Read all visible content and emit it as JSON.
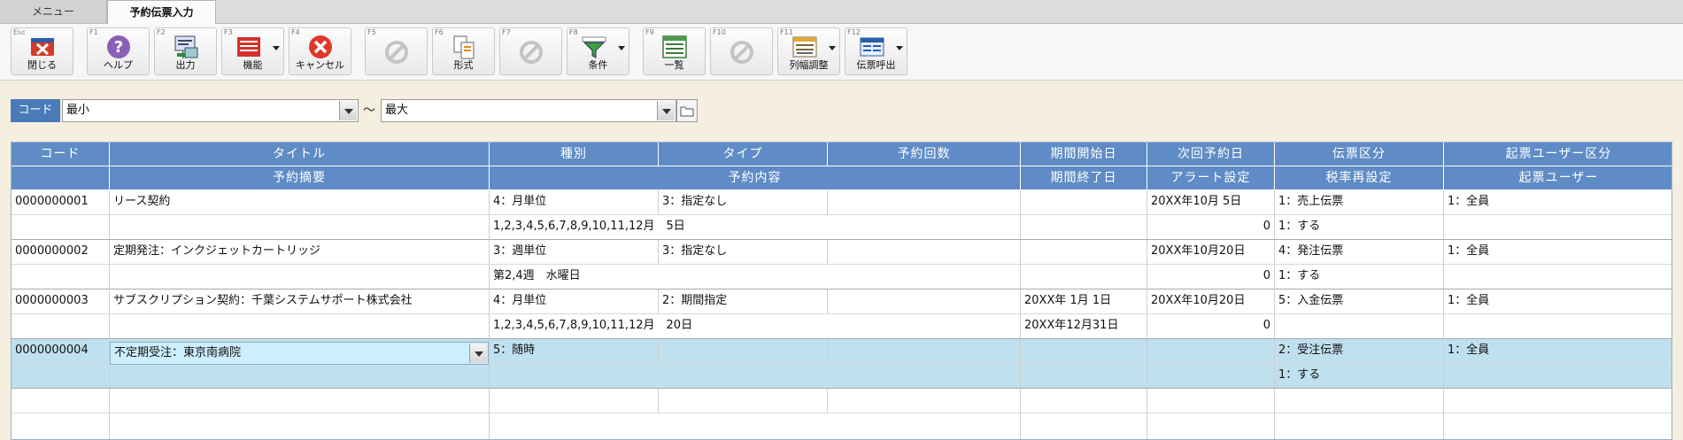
{
  "tabs": {
    "menu": "メニュー",
    "active": "予約伝票入力"
  },
  "toolbar": [
    {
      "key": "Esc",
      "label": "閉じる",
      "icon": "close-window-icon",
      "enabled": true
    },
    {
      "key": "F1",
      "label": "ヘルプ",
      "icon": "help-icon",
      "enabled": true
    },
    {
      "key": "F2",
      "label": "出力",
      "icon": "output-icon",
      "enabled": true
    },
    {
      "key": "F3",
      "label": "機能",
      "icon": "function-icon",
      "enabled": true,
      "dropdown": true
    },
    {
      "key": "F4",
      "label": "キャンセル",
      "icon": "cancel-icon",
      "enabled": true
    },
    {
      "key": "F5",
      "label": "",
      "icon": "disabled-icon",
      "enabled": false
    },
    {
      "key": "F6",
      "label": "形式",
      "icon": "format-icon",
      "enabled": true
    },
    {
      "key": "F7",
      "label": "",
      "icon": "disabled-icon",
      "enabled": false
    },
    {
      "key": "F8",
      "label": "条件",
      "icon": "filter-icon",
      "enabled": true,
      "dropdown": true
    },
    {
      "key": "F9",
      "label": "一覧",
      "icon": "list-icon",
      "enabled": true
    },
    {
      "key": "F10",
      "label": "",
      "icon": "disabled-icon",
      "enabled": false
    },
    {
      "key": "F11",
      "label": "列幅調整",
      "icon": "column-width-icon",
      "enabled": true,
      "dropdown": true
    },
    {
      "key": "F12",
      "label": "伝票呼出",
      "icon": "slip-call-icon",
      "enabled": true,
      "dropdown": true
    }
  ],
  "filter": {
    "label": "コード",
    "from": "最小",
    "tilde": "〜",
    "to": "最大"
  },
  "grid": {
    "header_row1": [
      "コード",
      "タイトル",
      "種別",
      "タイプ",
      "予約回数",
      "期間開始日",
      "次回予約日",
      "伝票区分",
      "起票ユーザー区分"
    ],
    "header_row2": [
      "予約摘要",
      "予約内容",
      "期間終了日",
      "アラート設定",
      "税率再設定",
      "起票ユーザー"
    ],
    "records": [
      {
        "code": "0000000001",
        "title": "リース契約",
        "kind": "4：月単位",
        "type": "3：指定なし",
        "count": "",
        "start": "",
        "next": "20XX年10月 5日",
        "slip": " 1：売上伝票",
        "user_kind": "1：全員",
        "memo": "",
        "content": "1,2,3,4,5,6,7,8,9,10,11,12月　5日",
        "end": "",
        "alert": "0",
        "tax": "1：する",
        "user": ""
      },
      {
        "code": "0000000002",
        "title": "定期発注：インクジェットカートリッジ",
        "kind": "3：週単位",
        "type": "3：指定なし",
        "count": "",
        "start": "",
        "next": "20XX年10月20日",
        "slip": " 4：発注伝票",
        "user_kind": "1：全員",
        "memo": "",
        "content": "第2,4週　水曜日",
        "end": "",
        "alert": "0",
        "tax": "1：する",
        "user": ""
      },
      {
        "code": "0000000003",
        "title": "サブスクリプション契約：千葉システムサポート株式会社",
        "kind": "4：月単位",
        "type": "2：期間指定",
        "count": "",
        "start": "20XX年 1月 1日",
        "next": "20XX年10月20日",
        "slip": " 5：入金伝票",
        "user_kind": "1：全員",
        "memo": "",
        "content": "1,2,3,4,5,6,7,8,9,10,11,12月　20日",
        "end": "20XX年12月31日",
        "alert": "0",
        "tax": "",
        "user": ""
      },
      {
        "code": "0000000004",
        "title": "不定期受注：東京南病院",
        "kind": "5：随時",
        "type": "",
        "count": "",
        "start": "",
        "next": "",
        "slip": " 2：受注伝票",
        "user_kind": "1：全員",
        "memo": "",
        "content": "",
        "end": "",
        "alert": "",
        "tax": "1：する",
        "user": ""
      }
    ]
  },
  "colors": {
    "header": "#5f8cc6",
    "selected_row": "#bfe0ee",
    "background": "#f4efdf"
  }
}
